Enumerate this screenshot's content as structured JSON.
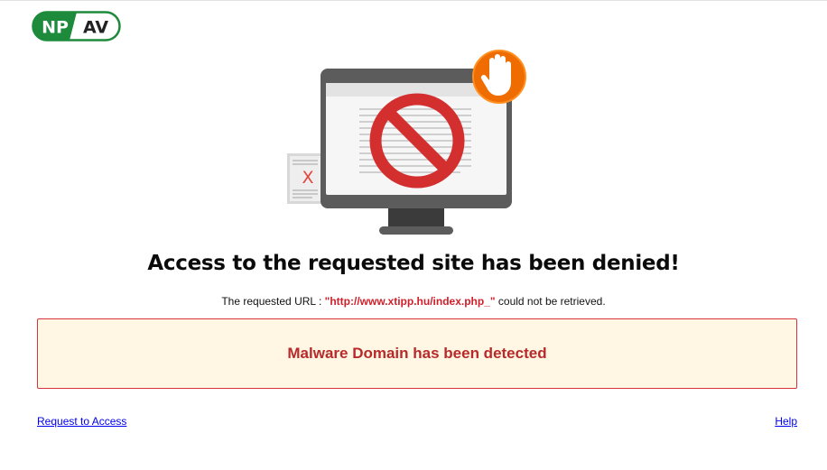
{
  "logo": {
    "left_text": "NP",
    "right_text": "AV",
    "brand_color": "#1e8a3c"
  },
  "illustration": {
    "icon": "monitor-blocked-icon",
    "badge_icon": "stop-hand-icon",
    "doc_icon": "blocked-document-icon",
    "doc_mark": "X"
  },
  "heading": "Access to the requested site has been denied!",
  "message": {
    "prefix": "The requested URL :",
    "url": "\"http://www.xtipp.hu/index.php_\"",
    "suffix": "could not be retrieved."
  },
  "alert": {
    "text": "Malware Domain has been detected"
  },
  "links": {
    "request_access": "Request to Access",
    "help": "Help"
  },
  "colors": {
    "alert_bg": "#fff6e4",
    "alert_border": "#d6333f",
    "alert_text": "#b82a2a",
    "url_text": "#d01f2a",
    "prohibit_red": "#d32f2f",
    "badge_orange": "#ef6c00"
  }
}
